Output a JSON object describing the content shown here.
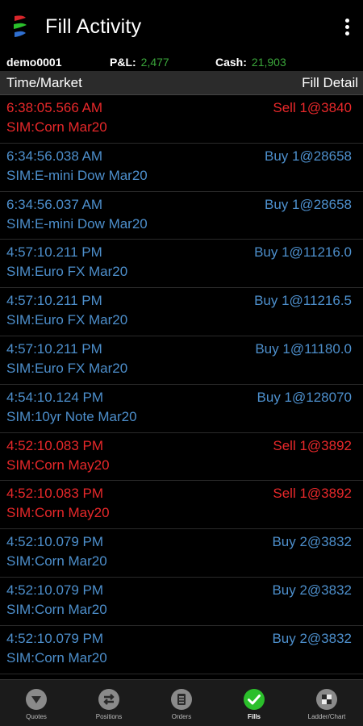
{
  "app": {
    "title": "Fill Activity"
  },
  "account": {
    "name": "demo0001",
    "pnl_label": "P&L:",
    "pnl_value": "2,477",
    "cash_label": "Cash:",
    "cash_value": "21,903"
  },
  "table": {
    "col_left": "Time/Market",
    "col_right": "Fill Detail"
  },
  "fills": [
    {
      "time": "6:38:05.566 AM",
      "market": "SIM:Corn Mar20",
      "detail": "Sell 1@3840",
      "side": "sell"
    },
    {
      "time": "6:34:56.038 AM",
      "market": "SIM:E-mini Dow Mar20",
      "detail": "Buy 1@28658",
      "side": "buy"
    },
    {
      "time": "6:34:56.037 AM",
      "market": "SIM:E-mini Dow Mar20",
      "detail": "Buy 1@28658",
      "side": "buy"
    },
    {
      "time": "4:57:10.211 PM",
      "market": "SIM:Euro FX Mar20",
      "detail": "Buy 1@11216.0",
      "side": "buy"
    },
    {
      "time": "4:57:10.211 PM",
      "market": "SIM:Euro FX Mar20",
      "detail": "Buy 1@11216.5",
      "side": "buy"
    },
    {
      "time": "4:57:10.211 PM",
      "market": "SIM:Euro FX Mar20",
      "detail": "Buy 1@11180.0",
      "side": "buy"
    },
    {
      "time": "4:54:10.124 PM",
      "market": "SIM:10yr Note Mar20",
      "detail": "Buy 1@128070",
      "side": "buy"
    },
    {
      "time": "4:52:10.083 PM",
      "market": "SIM:Corn May20",
      "detail": "Sell 1@3892",
      "side": "sell"
    },
    {
      "time": "4:52:10.083 PM",
      "market": "SIM:Corn May20",
      "detail": "Sell 1@3892",
      "side": "sell"
    },
    {
      "time": "4:52:10.079 PM",
      "market": "SIM:Corn Mar20",
      "detail": "Buy 2@3832",
      "side": "buy"
    },
    {
      "time": "4:52:10.079 PM",
      "market": "SIM:Corn Mar20",
      "detail": "Buy 2@3832",
      "side": "buy"
    },
    {
      "time": "4:52:10.079 PM",
      "market": "SIM:Corn Mar20",
      "detail": "Buy 2@3832",
      "side": "buy"
    }
  ],
  "nav": {
    "quotes": "Quotes",
    "positions": "Positions",
    "orders": "Orders",
    "fills": "Fills",
    "ladder": "Ladder/Chart"
  },
  "colors": {
    "sell": "#e8282a",
    "buy": "#4d8fcc",
    "positive": "#3aa53a",
    "active_nav": "#2bbf2b"
  }
}
